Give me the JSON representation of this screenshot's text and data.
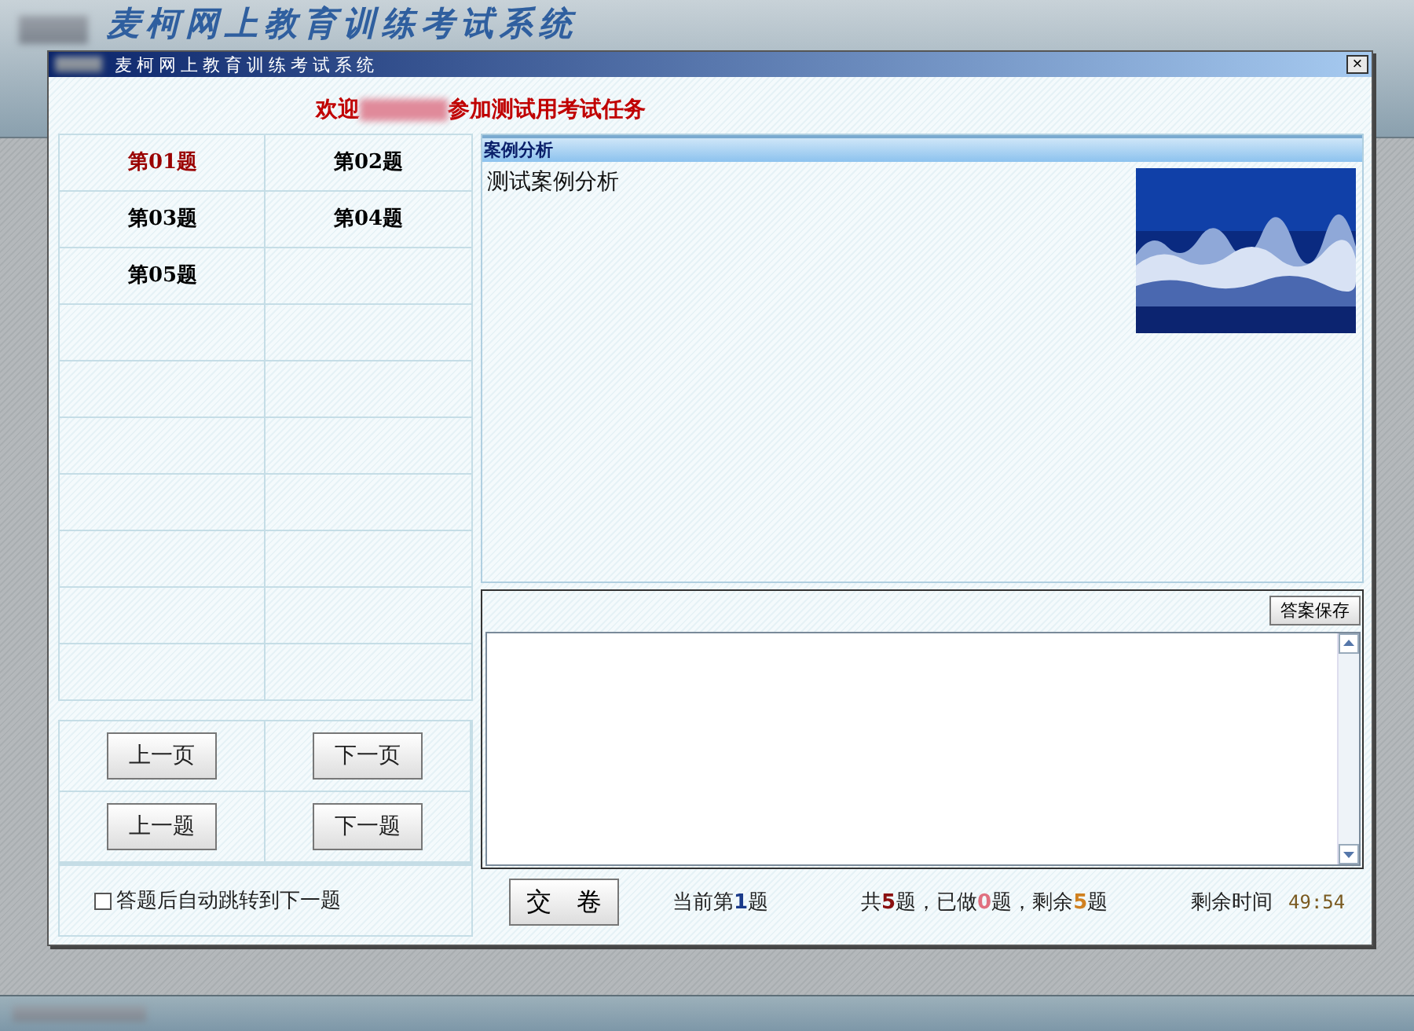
{
  "background_title": "麦柯网上教育训练考试系统",
  "window": {
    "title": "麦柯网上教育训练考试系统",
    "close": "×"
  },
  "welcome": {
    "before": "欢迎",
    "after": "参加测试用考试任务"
  },
  "questions": [
    {
      "label": "第01题",
      "selected": true
    },
    {
      "label": "第02题",
      "selected": false
    },
    {
      "label": "第03题",
      "selected": false
    },
    {
      "label": "第04题",
      "selected": false
    },
    {
      "label": "第05题",
      "selected": false
    }
  ],
  "nav_buttons": [
    "上一页",
    "下一页",
    "上一题",
    "下一题"
  ],
  "auto_jump": {
    "label": "答题后自动跳转到下一题",
    "checked": false
  },
  "case": {
    "header": "案例分析",
    "text": "测试案例分析"
  },
  "answer": {
    "save_button": "答案保存"
  },
  "submit_button": "交　卷",
  "status": [
    {
      "segments": [
        {
          "text": "当前第"
        },
        {
          "text": "1",
          "color": "#1a3a8a"
        },
        {
          "text": "题"
        }
      ]
    },
    {
      "segments": [
        {
          "text": "共"
        },
        {
          "text": "5",
          "color": "#8b1010"
        },
        {
          "text": "题，已做"
        },
        {
          "text": "0",
          "color": "#e07080"
        },
        {
          "text": "题，剩余"
        },
        {
          "text": "5",
          "color": "#d08020"
        },
        {
          "text": "题"
        }
      ]
    }
  ],
  "timer": {
    "label": "剩余时间",
    "value": "49:54"
  }
}
